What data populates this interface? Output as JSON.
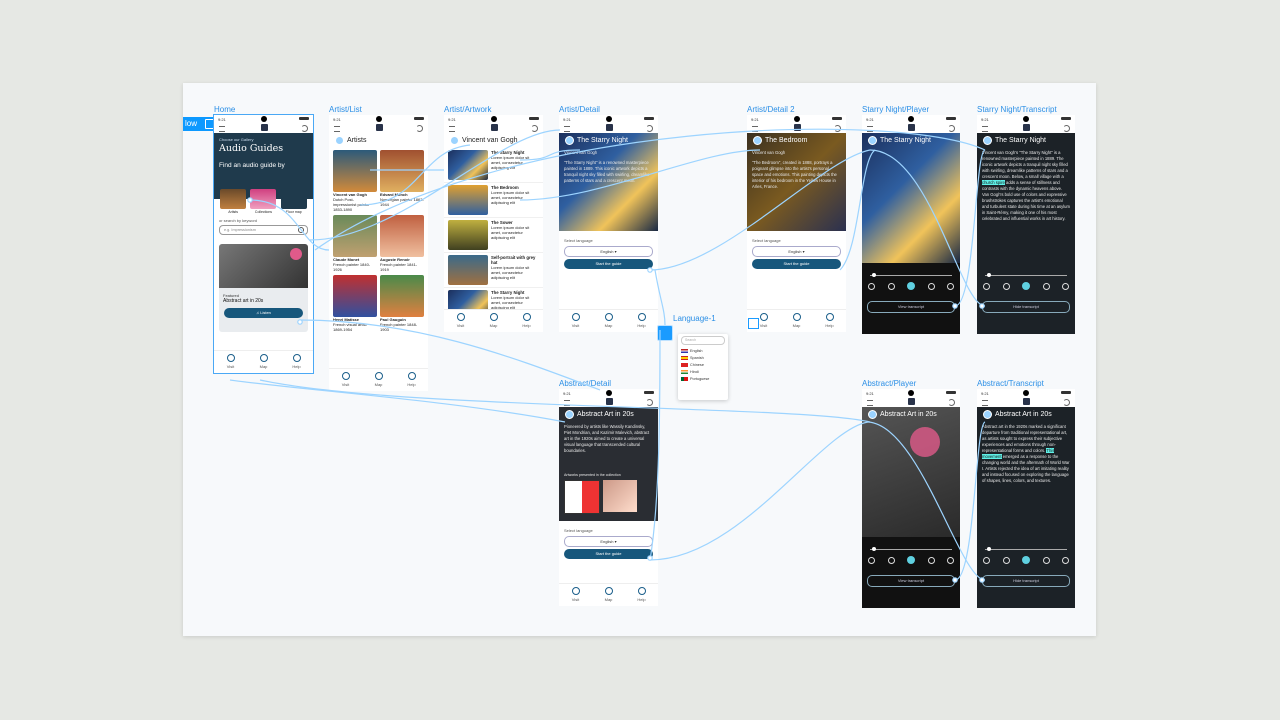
{
  "flow_tab": "low",
  "frame_labels": {
    "home": "Home",
    "artist_list": "Artist/List",
    "artist_artwork": "Artist/Artwork",
    "artist_detail": "Artist/Detail",
    "artist_detail2": "Artist/Detail 2",
    "starry_player": "Starry Night/Player",
    "starry_transcript": "Starry Night/Transcript",
    "language": "Language-1",
    "abstract_detail": "Abstract/Detail",
    "abstract_player": "Abstract/Player",
    "abstract_transcript": "Abstract/Transcript"
  },
  "status_time": "9:21",
  "home": {
    "eyebrow": "Choose our Gallery",
    "title": "Audio Guides",
    "subtitle": "Find an audio guide by",
    "categories": [
      "Artists",
      "Collections",
      "Floor map"
    ],
    "search_label": "or search by keyword",
    "search_placeholder": "e.g. Impressionism",
    "featured_label": "Featured",
    "featured_title": "Abstract art in 20s",
    "listen_label": "Listen"
  },
  "nav": {
    "visit": "Visit",
    "map": "Map",
    "help": "Help"
  },
  "artists": {
    "title": "Artists",
    "items": [
      {
        "name": "Vincent van Gogh",
        "desc": "Dutch Post-impressionist painter 1853-1890"
      },
      {
        "name": "Edvard Munch",
        "desc": "Norwegian painter 1863-1944"
      },
      {
        "name": "Claude Monet",
        "desc": "French painter 1840-1926"
      },
      {
        "name": "Auguste Renoir",
        "desc": "French painter 1841-1919"
      },
      {
        "name": "Henri Matisse",
        "desc": "French visual artist 1869-1954"
      },
      {
        "name": "Paul Gauguin",
        "desc": "French painter 1848-1903"
      }
    ]
  },
  "artwork": {
    "title": "Vincent van Gogh",
    "desc": "Lorem ipsum dolor sit amet, consectetur adipiscing elit",
    "items": [
      "The Starry Night",
      "The Bedroom",
      "The Sower",
      "Self-portrait with grey hat",
      "The Starry Night"
    ]
  },
  "detail": {
    "title": "The Starry Night",
    "artist": "Vincent van Gogh",
    "body": "\"The Starry Night\" is a renowned masterpiece painted in 1889. This iconic artwork depicts a tranquil night sky filled with swirling, dreamlike patterns of stars and a crescent moon.",
    "select_language": "Select language",
    "language": "English",
    "start": "Start the guide"
  },
  "detail2": {
    "title": "The Bedroom",
    "artist": "Vincent van Gogh",
    "body": "\"The Bedroom\", created in 1888, portrays a poignant glimpse into the artist's personal space and emotions. This painting depicts the interior of his bedroom in the Yellow House in Arles, France."
  },
  "player": {
    "view_transcript": "View transcript",
    "hide_transcript": "Hide transcript"
  },
  "transcript": {
    "title": "The Starry Night",
    "before": "Vincent van Gogh's \"The Starry Night\" is a renowned masterpiece painted in 1889. The iconic artwork depicts a tranquil night sky filled with swirling, dreamlike patterns of stars and a crescent moon. Below, a small village with a",
    "highlight": "church spire",
    "after": "adds a sense of stillness and contrasts with the dynamic heavens above. Van Gogh's bold use of colors and expressive brushstrokes captures the artist's emotional and turbulent state during his time at an asylum in Saint-Rémy, making it one of his most celebrated and influential works in art history."
  },
  "language_menu": {
    "search": "Search",
    "items": [
      "English",
      "Spanish",
      "Chinese",
      "Hindi",
      "Portuguese"
    ]
  },
  "abstract": {
    "title": "Abstract Art in 20s",
    "body": "Pioneered by artists like Wassily Kandinsky, Piet Mondrian, and Kazimir Malevich, abstract art in the 1920s aimed to create a universal visual language that transcended cultural boundaries.",
    "gallery_label": "Artworks presented in the collection"
  },
  "abstract_transcript": {
    "before": "Abstract art in the 1920s marked a significant departure from traditional representational art, as artists sought to express their subjective experiences and emotions through non-representational forms and colors.",
    "highlight": "This movement",
    "after": "emerged as a response to the changing world and the aftermath of World War I. Artists rejected the idea of art imitating reality and instead focused on exploring the language of shapes, lines, colors, and textures."
  },
  "colors": {
    "accent": "#17577c",
    "wire": "#9dd4ff",
    "selection": "#2b8fe6",
    "highlight": "#5ff0e8"
  }
}
